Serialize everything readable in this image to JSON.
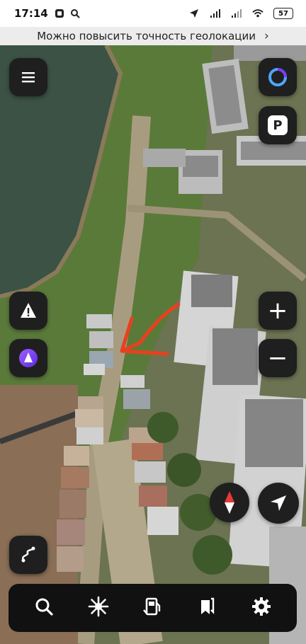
{
  "status_bar": {
    "time": "17:14",
    "battery": "57"
  },
  "geo_banner": {
    "text": "Можно повысить точность геолокации",
    "chevron": "›"
  },
  "map": {
    "type": "satellite",
    "annotation_color": "#e8401f"
  },
  "buttons": {
    "menu_icon": "hamburger-menu-icon",
    "alice_top_icon": "alice-ring-icon",
    "parking_label": "P",
    "road_alert_icon": "warning-triangle-icon",
    "alice_icon": "alice-assistant-icon",
    "zoom_in": "+",
    "zoom_out": "−",
    "compass_icon": "compass-icon",
    "locate_icon": "navigation-arrow-icon",
    "route_icon": "route-icon"
  },
  "toolbar": {
    "items": [
      "search-icon",
      "explore-icon",
      "fuel-icon",
      "bookmarks-icon",
      "settings-icon"
    ]
  },
  "colors": {
    "button_bg": "#1f1f1f",
    "alice_purple": "#7b3cf2",
    "compass_red": "#e53935"
  }
}
